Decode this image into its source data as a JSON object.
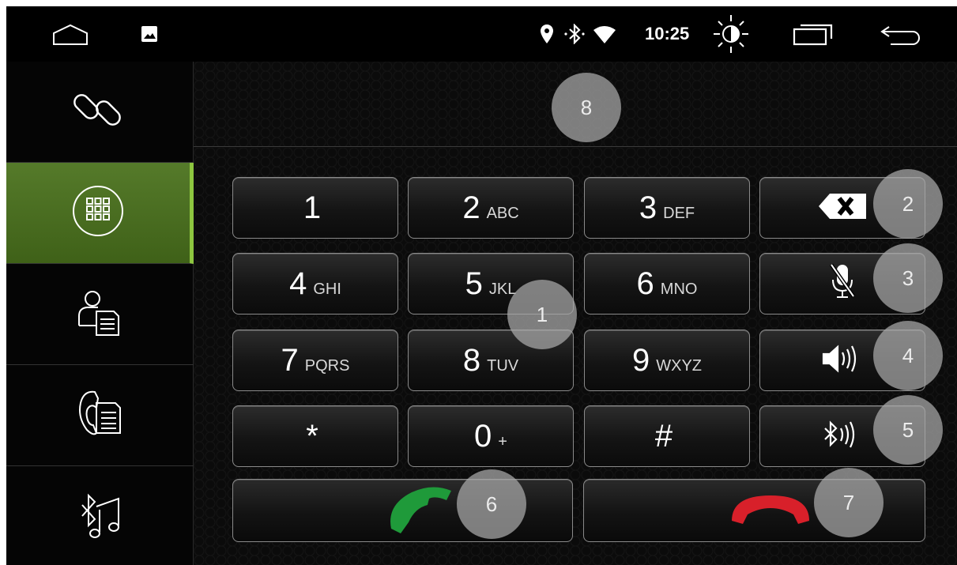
{
  "status_bar": {
    "time": "10:25",
    "icons": [
      "home-icon",
      "gallery-icon",
      "location-icon",
      "bluetooth-icon",
      "wifi-icon",
      "brightness-icon",
      "recent-apps-icon",
      "back-icon"
    ]
  },
  "sidebar": {
    "items": [
      {
        "icon": "link-icon"
      },
      {
        "icon": "dialpad-icon",
        "active": true
      },
      {
        "icon": "contacts-icon"
      },
      {
        "icon": "call-log-icon"
      },
      {
        "icon": "bluetooth-music-icon"
      }
    ],
    "accent": "#8dc63f"
  },
  "keypad": {
    "keys": [
      {
        "digit": "1",
        "letters": ""
      },
      {
        "digit": "2",
        "letters": "ABC"
      },
      {
        "digit": "3",
        "letters": "DEF"
      },
      {
        "digit": "4",
        "letters": "GHI"
      },
      {
        "digit": "5",
        "letters": "JKL"
      },
      {
        "digit": "6",
        "letters": "MNO"
      },
      {
        "digit": "7",
        "letters": "PQRS"
      },
      {
        "digit": "8",
        "letters": "TUV"
      },
      {
        "digit": "9",
        "letters": "WXYZ"
      },
      {
        "digit": "*",
        "letters": ""
      },
      {
        "digit": "0",
        "letters": "+"
      },
      {
        "digit": "#",
        "letters": ""
      }
    ],
    "side_buttons": [
      "backspace-icon",
      "mic-mute-icon",
      "speaker-icon",
      "bluetooth-audio-icon"
    ],
    "call_color": "#1f9a3a",
    "hangup_color": "#d8202a"
  },
  "markers": [
    "1",
    "2",
    "3",
    "4",
    "5",
    "6",
    "7",
    "8"
  ]
}
